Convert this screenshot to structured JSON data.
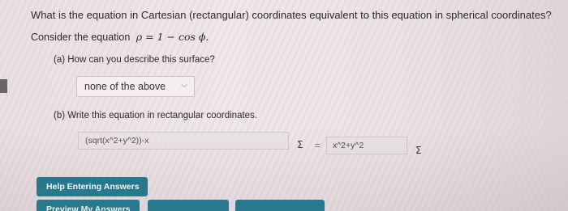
{
  "question": {
    "title": "What is the equation in Cartesian (rectangular) coordinates equivalent to this equation in spherical coordinates?",
    "consider_label": "Consider the equation",
    "equation": "ρ = 1 − cos ϕ."
  },
  "part_a": {
    "prompt": "(a) How can you describe this surface?",
    "selected": "none of the above"
  },
  "part_b": {
    "prompt": "(b) Write this equation in rectangular coordinates.",
    "lhs_value": "(sqrt(x^2+y^2))-x",
    "equals": "=",
    "rhs_value": "x^2+y^2",
    "sigma_symbol": "Σ"
  },
  "buttons": {
    "help": "Help Entering Answers",
    "preview": "Preview My Answers"
  }
}
